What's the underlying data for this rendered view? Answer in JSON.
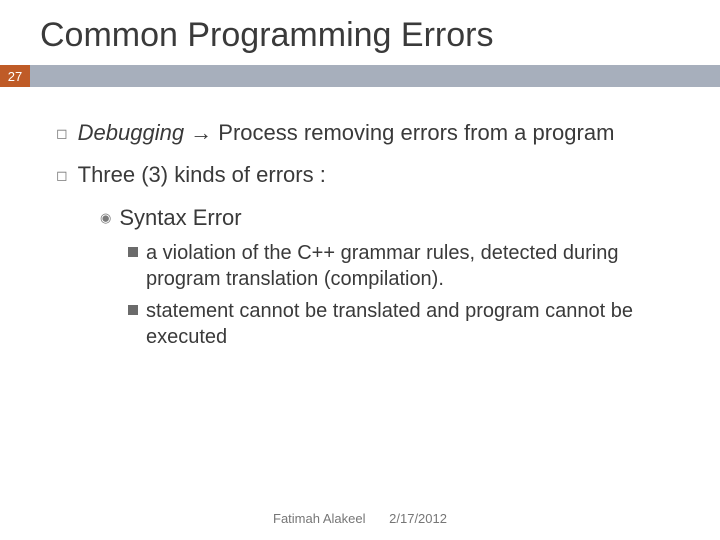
{
  "title": "Common Programming Errors",
  "page_number": "27",
  "bullets": {
    "l1a_prefix": "Debugging",
    "l1a_arrow": " → ",
    "l1a_rest": "Process removing errors from a program",
    "l1b": "Three (3) kinds of errors :",
    "l2a": "Syntax Error",
    "l3a": "a violation of the C++ grammar rules, detected during program translation (compilation).",
    "l3b": "statement cannot be translated and program cannot be executed"
  },
  "footer": {
    "author": "Fatimah Alakeel",
    "date": "2/17/2012"
  }
}
